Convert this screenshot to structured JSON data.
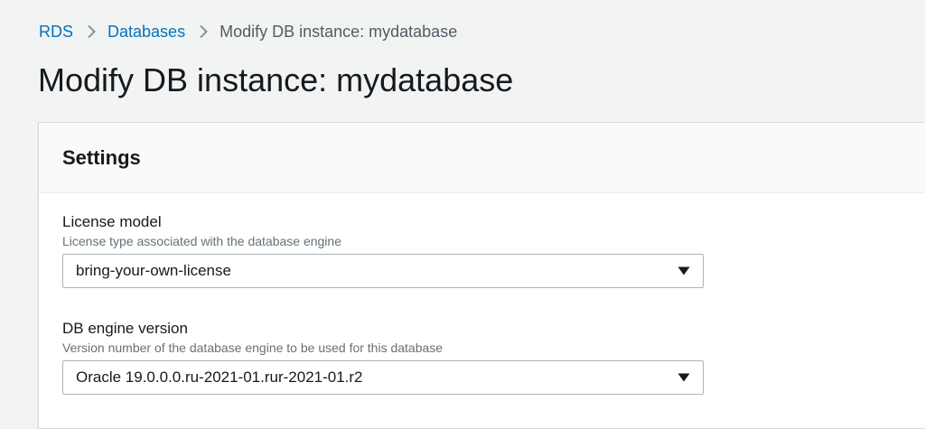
{
  "breadcrumb": {
    "items": [
      "RDS",
      "Databases"
    ],
    "current": "Modify DB instance: mydatabase"
  },
  "page": {
    "title": "Modify DB instance: mydatabase"
  },
  "settings": {
    "title": "Settings",
    "license_model": {
      "label": "License model",
      "description": "License type associated with the database engine",
      "value": "bring-your-own-license"
    },
    "engine_version": {
      "label": "DB engine version",
      "description": "Version number of the database engine to be used for this database",
      "value": "Oracle 19.0.0.0.ru-2021-01.rur-2021-01.r2"
    }
  },
  "icons": {
    "breadcrumb_separator": "chevron-right-icon",
    "dropdown": "caret-down-icon"
  },
  "colors": {
    "link": "#0073bb",
    "background": "#f2f3f3",
    "panel_header": "#fafafa",
    "text": "#16191f",
    "muted_text": "#687078"
  }
}
